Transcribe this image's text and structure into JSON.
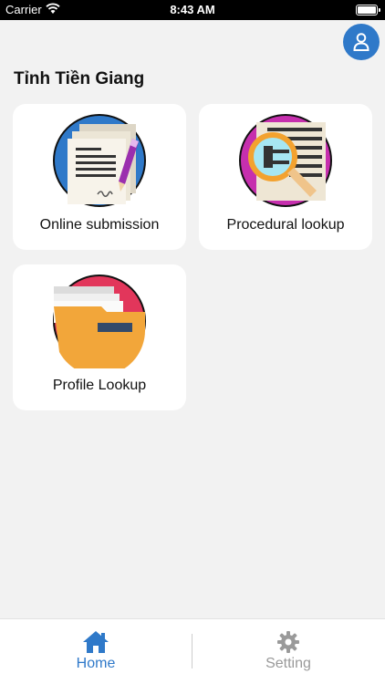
{
  "status_bar": {
    "carrier": "Carrier",
    "time": "8:43 AM"
  },
  "page": {
    "title": "Tỉnh Tiền Giang"
  },
  "cards": [
    {
      "label": "Online submission",
      "icon": "document-pen-icon",
      "circle_color": "#2f79c9"
    },
    {
      "label": "Procedural lookup",
      "icon": "magnifier-document-icon",
      "circle_color": "#c62fae"
    },
    {
      "label": "Profile Lookup",
      "icon": "folder-icon",
      "circle_color": "#e2365b"
    }
  ],
  "tab_bar": {
    "home_label": "Home",
    "setting_label": "Setting",
    "active_color": "#2f79c9",
    "inactive_color": "#999999"
  }
}
